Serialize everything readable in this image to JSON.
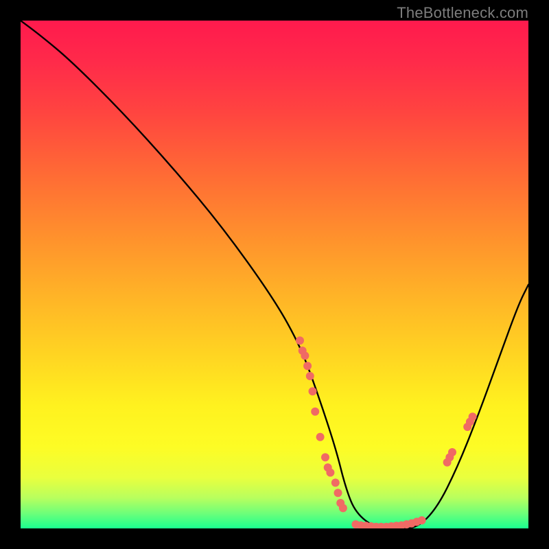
{
  "watermark": "TheBottleneck.com",
  "colors": {
    "background_black": "#000000",
    "dot": "#f06a64",
    "curve": "#000000",
    "gradient_stops": [
      "#ff1a4d",
      "#ff2a4a",
      "#ff4440",
      "#ff6a35",
      "#ff8f2d",
      "#ffb327",
      "#ffd522",
      "#fff21f",
      "#fdfc25",
      "#e9ff3e",
      "#b8ff5e",
      "#6eff79",
      "#1aff8f"
    ]
  },
  "chart_data": {
    "type": "line",
    "title": "",
    "xlabel": "",
    "ylabel": "",
    "xlim": [
      0,
      100
    ],
    "ylim": [
      0,
      100
    ],
    "note": "No axes, ticks, or legend are rendered in the image. Values are pixel-read estimates on a 0–100 normalized domain, where y=0 is the bottom (flat green minimum) and y=100 the top.",
    "series": [
      {
        "name": "bottleneck-curve",
        "x": [
          0,
          4,
          10,
          20,
          30,
          40,
          50,
          55,
          58,
          62,
          64,
          66,
          70,
          74,
          78,
          82,
          86,
          90,
          94,
          98,
          100
        ],
        "y": [
          100,
          97,
          92,
          82,
          71,
          59,
          45,
          36,
          28,
          16,
          8,
          3,
          0,
          0,
          0,
          4,
          12,
          22,
          33,
          44,
          48
        ]
      }
    ],
    "marker_clusters": [
      {
        "name": "left-descent-cluster",
        "x": [
          55,
          55.5,
          56,
          56.5,
          57,
          57.5,
          58,
          59,
          60,
          60.5,
          61,
          62,
          62.5,
          63,
          63.5
        ],
        "y": [
          37,
          35,
          34,
          32,
          30,
          27,
          23,
          18,
          14,
          12,
          11,
          9,
          7,
          5,
          4
        ]
      },
      {
        "name": "trough-cluster",
        "x": [
          66,
          67,
          68,
          69,
          70,
          71,
          72,
          73,
          74,
          75,
          76,
          77,
          78,
          79
        ],
        "y": [
          0.8,
          0.6,
          0.5,
          0.4,
          0.3,
          0.3,
          0.3,
          0.4,
          0.5,
          0.6,
          0.8,
          1.0,
          1.3,
          1.6
        ]
      },
      {
        "name": "right-rise-cluster",
        "x": [
          84,
          84.5,
          85,
          88,
          88.5,
          89
        ],
        "y": [
          13,
          14,
          15,
          20,
          21,
          22
        ]
      }
    ]
  }
}
